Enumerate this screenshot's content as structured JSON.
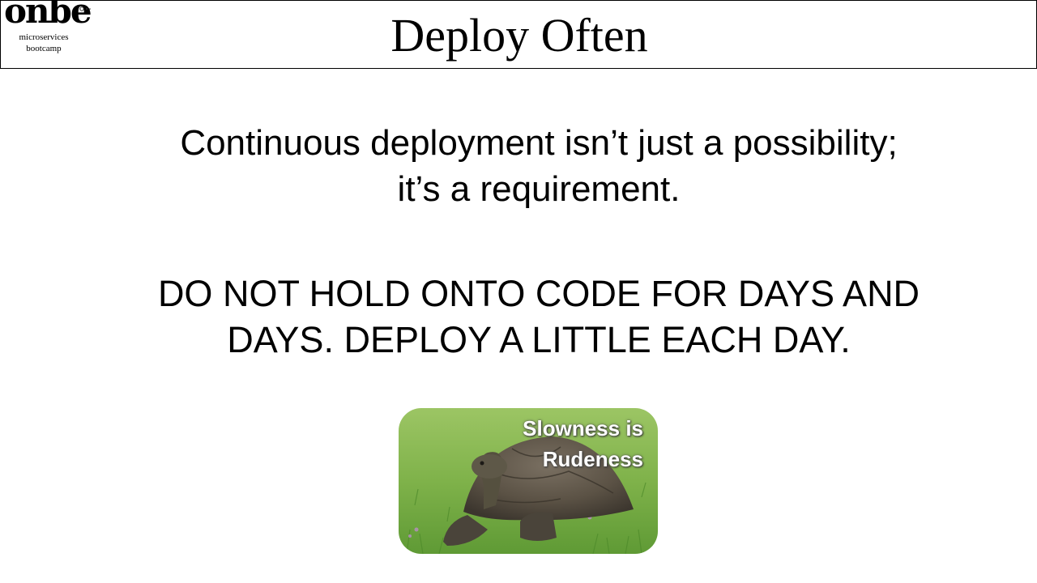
{
  "logo": {
    "word": "onbe",
    "tagline_line1": "microservices",
    "tagline_line2": "bootcamp"
  },
  "slide": {
    "title": "Deploy Often",
    "statement_line1": "Continuous deployment isn’t just a possibility;",
    "statement_line2": "it’s a requirement.",
    "emphasis_line1": "DO NOT HOLD ONTO CODE FOR DAYS AND",
    "emphasis_line2": "DAYS. DEPLOY A LITTLE EACH DAY."
  },
  "image": {
    "subject": "tortoise-on-grass",
    "caption_line1": "Slowness is",
    "caption_line2": "Rudeness"
  },
  "colors": {
    "grass": "#7fb24a",
    "shell": "#5b5245",
    "caption_text": "#ffffff"
  }
}
